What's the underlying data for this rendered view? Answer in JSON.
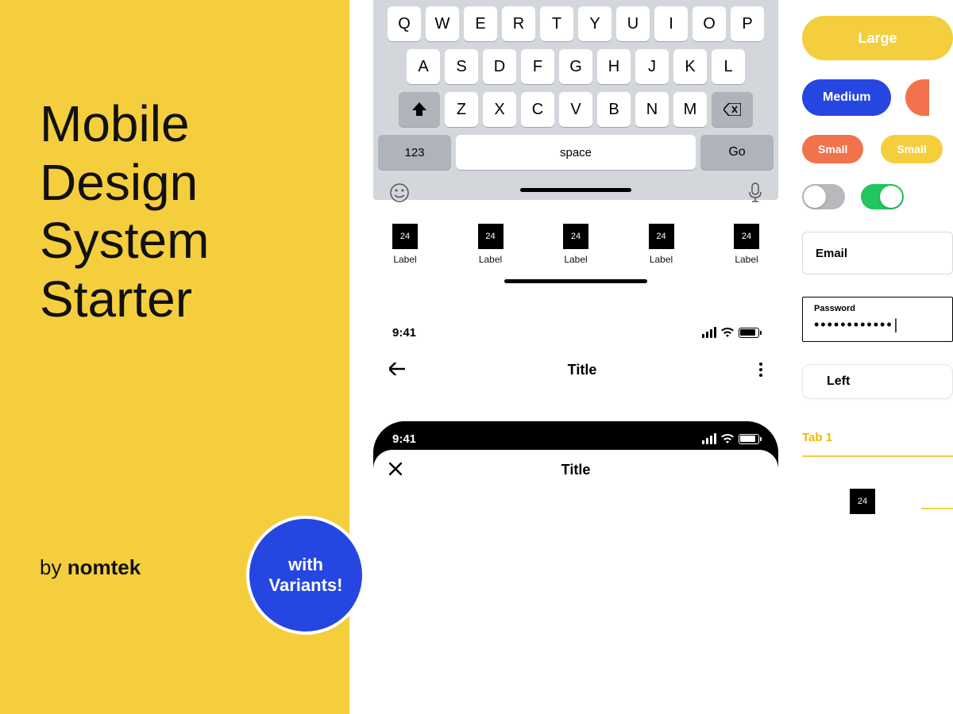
{
  "left": {
    "heading_l1": "Mobile",
    "heading_l2": "Design",
    "heading_l3": "System",
    "heading_l4": "Starter",
    "by": "by ",
    "brand": "nomtek",
    "badge_l1": "with",
    "badge_l2": "Variants!"
  },
  "keyboard": {
    "row1": [
      "Q",
      "W",
      "E",
      "R",
      "T",
      "Y",
      "U",
      "I",
      "O",
      "P"
    ],
    "row2": [
      "A",
      "S",
      "D",
      "F",
      "G",
      "H",
      "J",
      "K",
      "L"
    ],
    "row3": [
      "Z",
      "X",
      "C",
      "V",
      "B",
      "N",
      "M"
    ],
    "k123": "123",
    "kspace": "space",
    "kgo": "Go"
  },
  "tabbar": {
    "items": [
      {
        "icon": "24",
        "label": "Label"
      },
      {
        "icon": "24",
        "label": "Label"
      },
      {
        "icon": "24",
        "label": "Label"
      },
      {
        "icon": "24",
        "label": "Label"
      },
      {
        "icon": "24",
        "label": "Label"
      }
    ]
  },
  "status": {
    "time": "9:41"
  },
  "nav": {
    "title": "Title",
    "title2": "Title"
  },
  "buttons": {
    "large": "Large",
    "medium": "Medium",
    "small": "Small",
    "small2": "Small"
  },
  "inputs": {
    "email": "Email",
    "pwlabel": "Password",
    "pwdots": "••••••••••••"
  },
  "segment": {
    "left": "Left"
  },
  "tabs": {
    "t1": "Tab 1"
  },
  "last": {
    "icon": "24"
  }
}
